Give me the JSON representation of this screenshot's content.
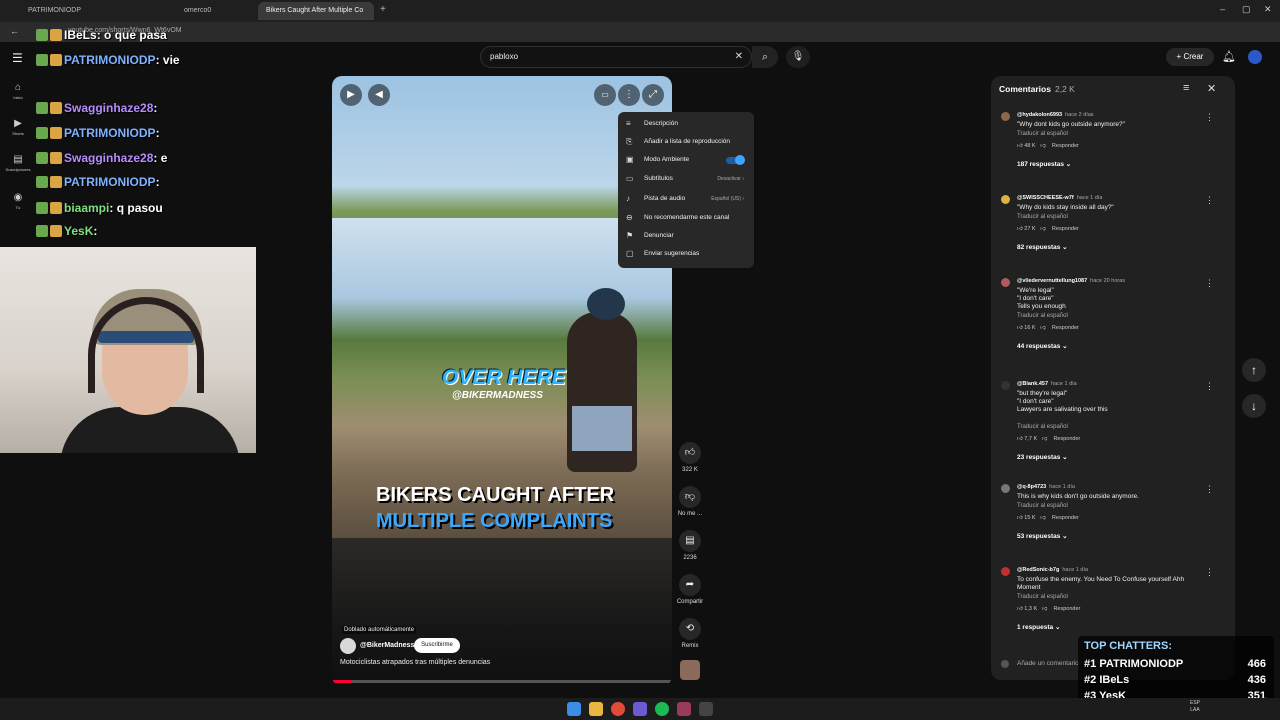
{
  "browser": {
    "tabs": [
      {
        "label": "PATRIMONIODP"
      },
      {
        "label": "omerco0"
      },
      {
        "label": "Bikers Caught After Multiple Co"
      }
    ],
    "url": "youtube.com/shorts/Wwn6_Wt6vOM"
  },
  "youtube": {
    "search": {
      "value": "pabloxo"
    },
    "create_label": "Crear",
    "side_nav": [
      {
        "icon": "home-icon",
        "label": "Inicio"
      },
      {
        "icon": "shorts-icon",
        "label": "Shorts"
      },
      {
        "icon": "subscriptions-icon",
        "label": "Suscripciones"
      },
      {
        "icon": "you-icon",
        "label": "Tú"
      }
    ]
  },
  "video": {
    "overlay_text": "OVER HERE",
    "overlay_handle": "@BIKERMADNESS",
    "caption_line1": "BIKERS CAUGHT AFTER",
    "caption_line2": "MULTIPLE COMPLAINTS",
    "dub_label": "Doblado automáticamente",
    "channel": "@BikerMadness",
    "subscribe_label": "Suscribirme",
    "title": "Motociclistas atrapados tras múltiples denuncias",
    "progress": 0.06
  },
  "actions": [
    {
      "icon": "like-icon",
      "label": "322 K"
    },
    {
      "icon": "dislike-icon",
      "label": "No me ..."
    },
    {
      "icon": "comment-icon",
      "label": "2236"
    },
    {
      "icon": "share-icon",
      "label": "Compartir"
    },
    {
      "icon": "remix-icon",
      "label": "Remix"
    }
  ],
  "menu": {
    "items": [
      {
        "icon": "description-icon",
        "label": "Descripción",
        "value": ""
      },
      {
        "icon": "playlist-add-icon",
        "label": "Añadir a lista de reproducción",
        "value": ""
      },
      {
        "icon": "ambient-icon",
        "label": "Modo Ambiente",
        "value": ""
      },
      {
        "icon": "subtitles-icon",
        "label": "Subtítulos",
        "value": "Desactivar"
      },
      {
        "icon": "audio-track-icon",
        "label": "Pista de audio",
        "value": "Español (US)"
      },
      {
        "icon": "block-icon",
        "label": "No recomendarme este canal",
        "value": ""
      },
      {
        "icon": "flag-icon",
        "label": "Denunciar",
        "value": ""
      },
      {
        "icon": "feedback-icon",
        "label": "Enviar sugerencias",
        "value": ""
      }
    ]
  },
  "comments": {
    "title": "Comentarios",
    "count": "2,2 K",
    "translate_label": "Traducir al español",
    "reply_label": "Responder",
    "add_placeholder": "Añade un comentario",
    "items": [
      {
        "author": "@hydakolon6993",
        "time": "hace 2 días",
        "text": "\"Why dont kids go outside anymore?\"",
        "likes": "48 K",
        "replies": "187 respuestas",
        "color": "#8a6a4a"
      },
      {
        "author": "@SWISSCHEESE-w7f",
        "time": "hace 1 día",
        "text": "\"Why do kids stay inside all day?\"",
        "likes": "27 K",
        "replies": "82 respuestas",
        "color": "#e0b040"
      },
      {
        "author": "@vliedervernuttellung1087",
        "time": "hace 20 horas",
        "text": "\"We're legal\"\n\"I don't care\"\nTells you enough",
        "likes": "16 K",
        "replies": "44 respuestas",
        "color": "#b05a5a"
      },
      {
        "author": "@Blank.457",
        "time": "hace 1 día",
        "text": "\"but they're legal\"\n\"I don't care\"\nLawyers are salivating over this",
        "likes": "7,7 K",
        "replies": "23 respuestas",
        "color": "#333333"
      },
      {
        "author": "@q-8p4723",
        "time": "hace 1 día",
        "text": "This is why kids don't go outside anymore.",
        "likes": "15 K",
        "replies": "53 respuestas",
        "color": "#777777"
      },
      {
        "author": "@RedSonic-b7g",
        "time": "hace 1 día",
        "text": "To confuse the enemy. You Need To Confuse yourself Ahh Moment",
        "likes": "1,3 K",
        "replies": "1 respuesta",
        "color": "#c03030"
      }
    ]
  },
  "chat": [
    {
      "user": "IBeLs",
      "message": "o que pasa",
      "color": "#ffffff"
    },
    {
      "user": "PATRIMONIODP",
      "message": "vie",
      "color": "#7fb2ff"
    },
    {
      "user": "Swagginhaze28",
      "message": "",
      "color": "#b78cff"
    },
    {
      "user": "PATRIMONIODP",
      "message": "",
      "color": "#7fb2ff"
    },
    {
      "user": "Swagginhaze28",
      "message": "e",
      "color": "#b78cff"
    },
    {
      "user": "PATRIMONIODP",
      "message": "",
      "color": "#7fb2ff"
    },
    {
      "user": "biaampi",
      "message": "q pasou",
      "color": "#7fe07f"
    },
    {
      "user": "YesK",
      "message": "",
      "color": "#7fe07f"
    }
  ],
  "top_chatters": {
    "title": "TOP CHATTERS:",
    "rows": [
      {
        "rank": "#1",
        "name": "PATRIMONIODP",
        "score": "466"
      },
      {
        "rank": "#2",
        "name": "IBeLs",
        "score": "436"
      },
      {
        "rank": "#3",
        "name": "YesK",
        "score": "351"
      }
    ]
  },
  "taskbar": {
    "lang": "ESP",
    "region": "LAA"
  }
}
